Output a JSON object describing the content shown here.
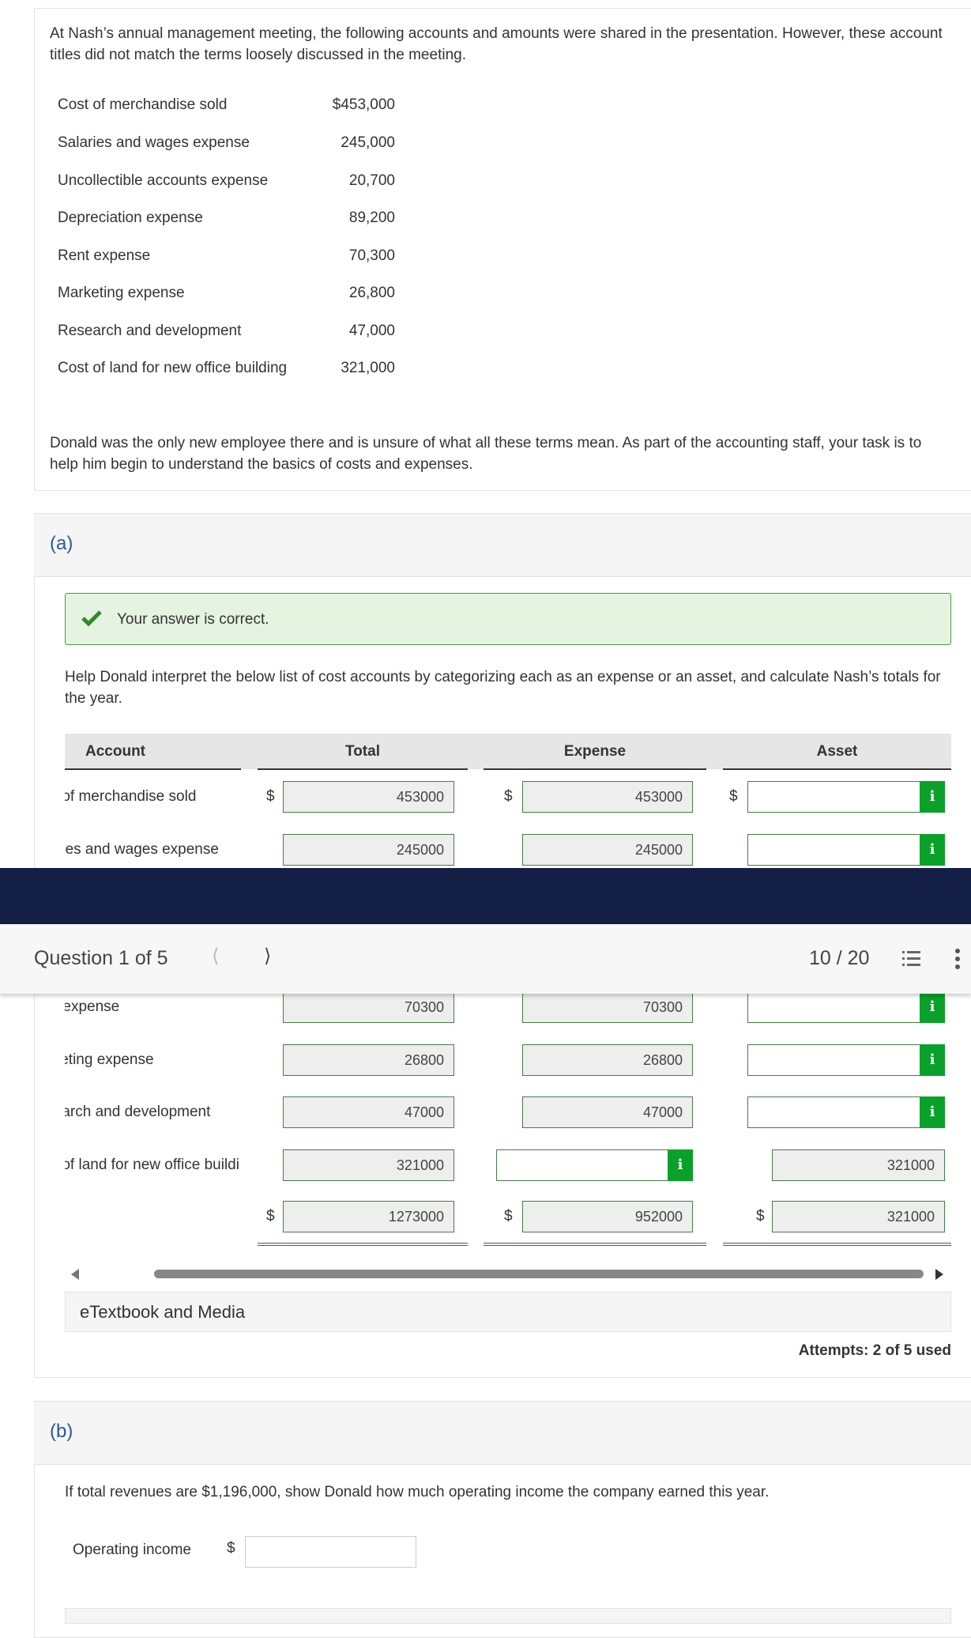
{
  "intro": "At Nash’s annual management meeting, the following accounts and amounts were shared in the presentation. However, these account titles did not match the terms loosely discussed in the meeting.",
  "accounts": [
    {
      "name": "Cost of merchandise sold",
      "amount": "$453,000"
    },
    {
      "name": "Salaries and wages expense",
      "amount": "245,000"
    },
    {
      "name": "Uncollectible accounts expense",
      "amount": "20,700"
    },
    {
      "name": "Depreciation expense",
      "amount": "89,200"
    },
    {
      "name": "Rent expense",
      "amount": "70,300"
    },
    {
      "name": "Marketing expense",
      "amount": "26,800"
    },
    {
      "name": "Research and development",
      "amount": "47,000"
    },
    {
      "name": "Cost of land for new office building",
      "amount": "321,000"
    }
  ],
  "outro": "Donald was the only new employee there and is unsure of what all these terms mean. As part of the accounting staff, your task is to help him begin to understand the basics of costs and expenses.",
  "part_a": {
    "label": "(a)",
    "feedback": "Your answer is correct.",
    "instructions": "Help Donald interpret the below list of cost accounts by categorizing each as an expense or an asset, and calculate Nash’s totals for the year.",
    "headers": [
      "Account",
      "Total",
      "Expense",
      "Asset"
    ],
    "currency": "$",
    "rows": [
      {
        "account": "Cost of merchandise sold",
        "total": "453000",
        "expense": "453000",
        "asset": ""
      },
      {
        "account": "Salaries and wages expense",
        "total": "245000",
        "expense": "245000",
        "asset": ""
      },
      {
        "account": "",
        "total": "",
        "expense": "",
        "asset": ""
      },
      {
        "account": "",
        "total": "",
        "expense": "",
        "asset": ""
      },
      {
        "account": "Rent expense",
        "total": "70300",
        "expense": "70300",
        "asset": ""
      },
      {
        "account": "Marketing expense",
        "total": "26800",
        "expense": "26800",
        "asset": ""
      },
      {
        "account": "Research and development",
        "total": "47000",
        "expense": "47000",
        "asset": ""
      },
      {
        "account": "Cost of land for new office building",
        "total": "321000",
        "expense": "",
        "asset": "321000"
      }
    ],
    "totals": {
      "total": "1273000",
      "expense": "952000",
      "asset": "321000"
    },
    "etextbook": "eTextbook and Media",
    "attempts": "Attempts: 2 of 5 used"
  },
  "question_bar": {
    "label": "Question 1 of 5",
    "score": "10 / 20"
  },
  "part_b": {
    "label": "(b)",
    "question": "If total revenues are $1,196,000, show Donald how much operating income the company earned this year.",
    "field_label": "Operating income",
    "currency": "$",
    "value": ""
  },
  "colors": {
    "navy": "#141f45",
    "correct_bg": "#e5f3e1",
    "info_green": "#0aa12a",
    "part_label": "#2b5a9c"
  }
}
